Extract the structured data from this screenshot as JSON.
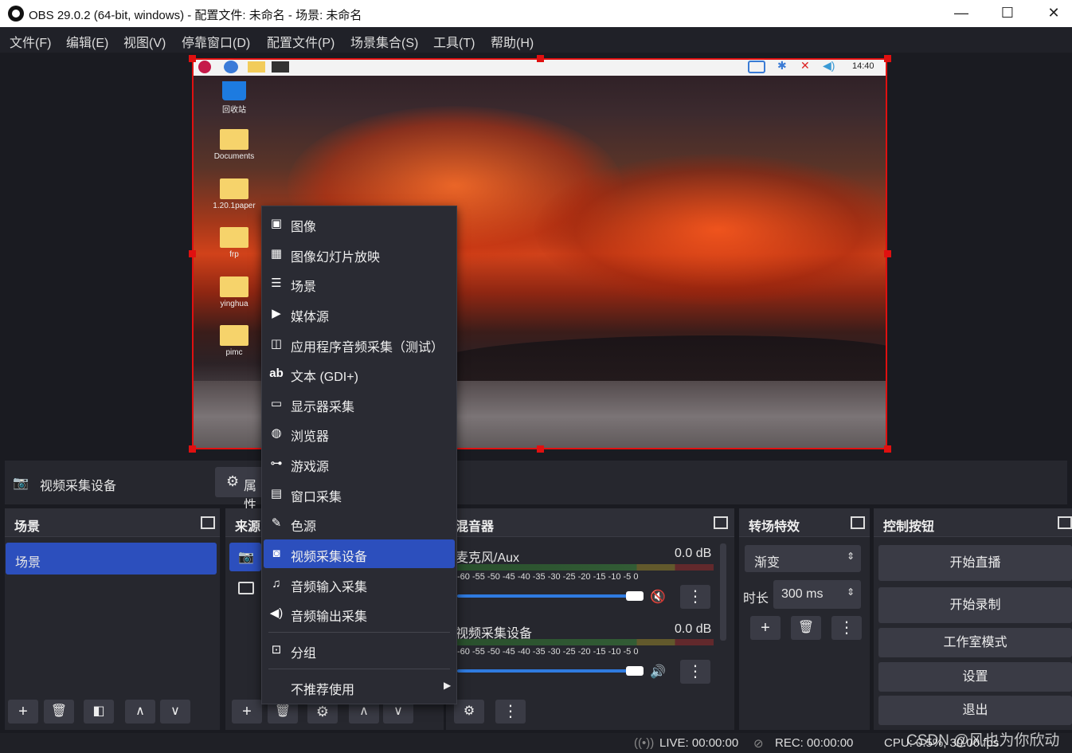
{
  "titlebar": {
    "title": "OBS 29.0.2 (64-bit, windows) - 配置文件: 未命名 - 场景: 未命名",
    "minimize": "—",
    "maximize": "☐",
    "close": "✕"
  },
  "menu": [
    "文件(F)",
    "编辑(E)",
    "视图(V)",
    "停靠窗口(D)",
    "配置文件(P)",
    "场景集合(S)",
    "工具(T)",
    "帮助(H)"
  ],
  "preview": {
    "clock": "14:40",
    "desktop_icons": [
      "回收站",
      "Documents",
      "1.20.1paper",
      "frp",
      "yinghua",
      "pimc"
    ]
  },
  "source_toolbar": {
    "source_name": "视频采集设备",
    "properties_label": "属性"
  },
  "scenes": {
    "title": "场景",
    "items": [
      "场景"
    ]
  },
  "sources": {
    "title": "来源"
  },
  "context_menu": {
    "items": [
      "图像",
      "图像幻灯片放映",
      "场景",
      "媒体源",
      "应用程序音频采集（测试）",
      "文本 (GDI+)",
      "显示器采集",
      "浏览器",
      "游戏源",
      "窗口采集",
      "色源",
      "视频采集设备",
      "音频输入采集",
      "音频输出采集"
    ],
    "group": "分组",
    "deprecated": "不推荐使用",
    "selected": "视频采集设备"
  },
  "mixer": {
    "title": "混音器",
    "scale": "-60 -55 -50 -45 -40 -35 -30 -25 -20 -15 -10 -5 0",
    "channels": [
      {
        "name": "麦克风/Aux",
        "db": "0.0 dB",
        "muted": true,
        "level": 0.95
      },
      {
        "name": "视频采集设备",
        "db": "0.0 dB",
        "muted": false,
        "level": 0.95
      }
    ]
  },
  "transitions": {
    "title": "转场特效",
    "transition": "渐变",
    "duration_label": "时长",
    "duration": "300 ms"
  },
  "controls": {
    "title": "控制按钮",
    "buttons": [
      "开始直播",
      "开始录制",
      "工作室模式",
      "设置",
      "退出"
    ]
  },
  "status": {
    "live": "LIVE: 00:00:00",
    "rec": "REC: 00:00:00",
    "cpu": "CPU: 0.5%, 30.00 fps",
    "watermark": "CSDN @风也为你欣动"
  },
  "colors": {
    "accent": "#2c4fbd",
    "selection_border": "#e01010",
    "muted": "#d22"
  }
}
